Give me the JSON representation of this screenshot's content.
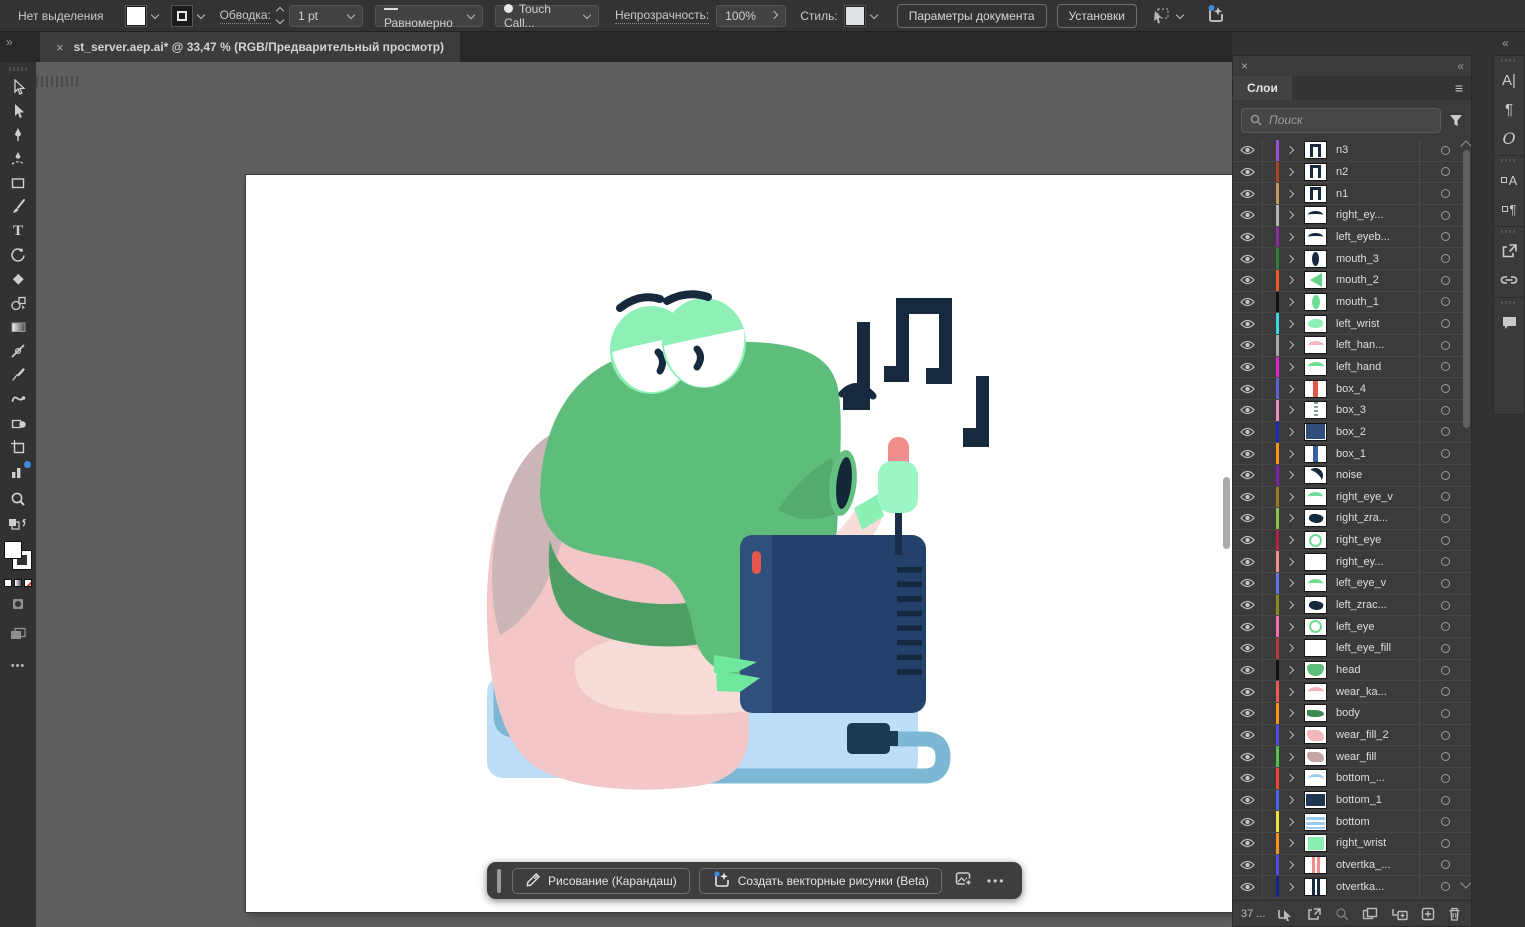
{
  "topbar": {
    "selection_status": "Нет выделения",
    "stroke_label": "Обводка:",
    "stroke_width": "1 pt",
    "stroke_profile": "Равномерно",
    "brush": "Touch Call...",
    "opacity_label": "Непрозрачность:",
    "opacity_value": "100%",
    "style_label": "Стиль:",
    "doc_setup_button": "Параметры документа",
    "preferences_button": "Установки"
  },
  "tab": {
    "title": "st_server.aep.ai* @ 33,47 % (RGB/Предварительный просмотр)",
    "close": "×"
  },
  "toolbar_left": {
    "tools": [
      "selection",
      "direct-selection",
      "pen",
      "curvature",
      "rectangle",
      "paintbrush",
      "type",
      "rotate",
      "eraser",
      "shape-builder",
      "gradient",
      "width",
      "eyedropper",
      "blob-brush",
      "symbol-sprayer",
      "artboard",
      "graph"
    ]
  },
  "layers_panel": {
    "title": "Слои",
    "search_placeholder": "Поиск",
    "status": "37 ...",
    "layers": [
      {
        "name": "n3",
        "color": "#9b4fd9",
        "thumb": "t-note"
      },
      {
        "name": "n2",
        "color": "#a8431f",
        "thumb": "t-note"
      },
      {
        "name": "n1",
        "color": "#c6975c",
        "thumb": "t-note"
      },
      {
        "name": "right_ey...",
        "color": "#b4b4b4",
        "thumb": "t-brow"
      },
      {
        "name": "left_eyeb...",
        "color": "#8a2b9e",
        "thumb": "t-brow"
      },
      {
        "name": "mouth_3",
        "color": "#2e7d36",
        "thumb": "t-ellipse-dark"
      },
      {
        "name": "mouth_2",
        "color": "#f05a28",
        "thumb": "t-tri-green"
      },
      {
        "name": "mouth_1",
        "color": "#111111",
        "thumb": "t-ellipse-green"
      },
      {
        "name": "left_wrist",
        "color": "#3cd3de",
        "thumb": "t-mint"
      },
      {
        "name": "left_han...",
        "color": "#a9a9a9",
        "thumb": "t-curve-pink"
      },
      {
        "name": "left_hand",
        "color": "#da26c8",
        "thumb": "t-curve-green"
      },
      {
        "name": "box_4",
        "color": "#5b63d3",
        "thumb": "t-bar-red"
      },
      {
        "name": "box_3",
        "color": "#ef8cb9",
        "thumb": "t-dashes"
      },
      {
        "name": "box_2",
        "color": "#1a2bb4",
        "thumb": "t-navy-fill"
      },
      {
        "name": "box_1",
        "color": "#f7941d",
        "thumb": "t-stripe-blue"
      },
      {
        "name": "noise",
        "color": "#7d22a8",
        "thumb": "t-curve-dark"
      },
      {
        "name": "right_eye_v",
        "color": "#9a7d23",
        "thumb": "t-arc-green"
      },
      {
        "name": "right_zra...",
        "color": "#8bc34a",
        "thumb": "t-blob-dark"
      },
      {
        "name": "right_eye",
        "color": "#b02347",
        "thumb": "t-ring-green"
      },
      {
        "name": "right_ey...",
        "color": "#f09090",
        "thumb": "t-white"
      },
      {
        "name": "left_eye_v",
        "color": "#6673e0",
        "thumb": "t-arc-green"
      },
      {
        "name": "left_zrac...",
        "color": "#8a8a20",
        "thumb": "t-blob-dark"
      },
      {
        "name": "left_eye",
        "color": "#f06eb0",
        "thumb": "t-ring-green"
      },
      {
        "name": "left_eye_fill",
        "color": "#b03a3a",
        "thumb": "t-white"
      },
      {
        "name": "head",
        "color": "#111111",
        "thumb": "t-blob-green"
      },
      {
        "name": "wear_ka...",
        "color": "#f0594f",
        "thumb": "t-curve-pink"
      },
      {
        "name": "body",
        "color": "#f7941d",
        "thumb": "t-wedge-green"
      },
      {
        "name": "wear_fill_2",
        "color": "#5050e0",
        "thumb": "t-blob-pink"
      },
      {
        "name": "wear_fill",
        "color": "#52c14e",
        "thumb": "t-blob-mauve"
      },
      {
        "name": "bottom_...",
        "color": "#f04438",
        "thumb": "t-curve-blue"
      },
      {
        "name": "bottom_1",
        "color": "#4966e8",
        "thumb": "t-navy-wide"
      },
      {
        "name": "bottom",
        "color": "#f0e040",
        "thumb": "t-stripes-blue"
      },
      {
        "name": "right_wrist",
        "color": "#f7941d",
        "thumb": "t-block-mint"
      },
      {
        "name": "otvertka_...",
        "color": "#5050e0",
        "thumb": "t-stripes-red"
      },
      {
        "name": "otvertka...",
        "color": "#16268a",
        "thumb": "t-stripes-dark"
      }
    ]
  },
  "right_dock": {
    "icons": [
      "character",
      "paragraph",
      "opentype",
      "character-styles",
      "paragraph-styles",
      "export",
      "links",
      "comments"
    ]
  },
  "bottom_toolbar": {
    "draw_label": "Рисование (Карандаш)",
    "vector_label": "Создать векторные рисунки (Beta)"
  },
  "illustration": {
    "subject": "green frog character fixing a server box with a screwdriver, music notes above",
    "colors": {
      "head_green": "#5fbd7b",
      "collar_green": "#4d9e64",
      "mint": "#9cf6c6",
      "body_pink": "#f3c6c7",
      "shadow_mauve": "#cbb5b6",
      "arm_pink": "#f8dcda",
      "screwdriver_red": "#ef8c8c",
      "navy": "#16293d",
      "server_blue": "#24416c",
      "server_strip": "#2f4f7c",
      "indicator_red": "#e4574f",
      "mat_blue": "#bcdef9",
      "cable_blue": "#7cb7d4",
      "accent_blue_dot": "#3f8ae0"
    }
  }
}
